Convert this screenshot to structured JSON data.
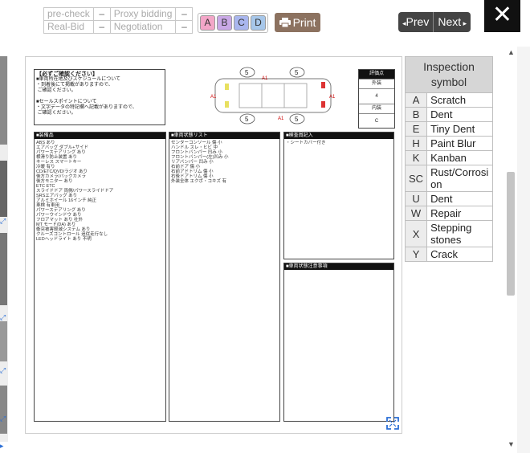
{
  "status": {
    "rows": [
      {
        "left_label": "pre-check",
        "left_value": "–",
        "right_label": "Proxy bidding",
        "right_value": "–"
      },
      {
        "left_label": "Real-Bid",
        "left_value": "–",
        "right_label": "Negotiation",
        "right_value": "–"
      }
    ]
  },
  "grade_buttons": [
    {
      "label": "A",
      "color": "#f3a6c8"
    },
    {
      "label": "B",
      "color": "#c9a8e6"
    },
    {
      "label": "C",
      "color": "#a9b6ee"
    },
    {
      "label": "D",
      "color": "#a7c7ea"
    }
  ],
  "print": {
    "label": "Print",
    "icon": "printer-icon"
  },
  "nav": {
    "prev_label": "Prev",
    "next_label": "Next"
  },
  "close": {
    "icon": "close-icon"
  },
  "sheet": {
    "confirm_title": "【必ずご確認ください】",
    "confirm_body": "■車両所在地及びスケジュールについて\n・到着後にて掲載がありますので、\n ご確認ください。\n\n■セールスポイントについて\n・文字データの特記欄へ記載がありますので、\n ご確認ください。",
    "rating_header": "評価点",
    "rating_exterior_label": "外装",
    "rating_exterior_value": "4",
    "rating_interior_label": "内装",
    "rating_interior_value": "C",
    "equipment_title": "■装備品",
    "equipment_body": "ABS あり\nエアバッグ ダブル+サイド\nパワーステアリング あり\n横滑り防止装置 あり\nキーレス スマートキー\n冷暖 有り\nCD/ETC/DVD/ラジオ あり\n後方カメラ/バックカメラ\n後方モニター あり\nETC ETC\nスライドドア 両側/パワースライドドア\nSRSエアバッグ あり\nアルミホイール 16インチ 純正\n車検 有車用\nパワーステアリング あり\nパワーウインドウ あり\nフロアマット あり 社外\nMT モード/DA) あり\n衝突被害軽減システム あり\nクルーズコントロール 追従走行なし\nLEDヘッドライト あり 不明",
    "condition_title": "■車両状態リスト",
    "condition_body": "センターコンソール 傷 小\nハンドル スレ・ヒビ 中\nフロントバンパー 凹み 小\nフロントバンパー(左)凹み 小\nリアバンパー 凹み 小\n右前ドア 傷 小\n右前アドトリム 傷 小\n右後ドアトリム 傷 小\n外装全体 エクボ・コキズ 有",
    "inspect_title": "■検査員記入",
    "inspect_body": "・シートカバー付き",
    "notes_title": "■車両状態注意事項",
    "notes_body": "",
    "diagram_marks": [
      "5",
      "5",
      "5",
      "5",
      "A1",
      "A1",
      "A1",
      "A1"
    ]
  },
  "legend": {
    "title": "Inspection symbol",
    "rows": [
      {
        "code": "A",
        "name": "Scratch"
      },
      {
        "code": "B",
        "name": "Dent"
      },
      {
        "code": "E",
        "name": "Tiny Dent"
      },
      {
        "code": "H",
        "name": "Paint Blur"
      },
      {
        "code": "K",
        "name": "Kanban"
      },
      {
        "code": "SC",
        "name": "Rust/Corrosion"
      },
      {
        "code": "U",
        "name": "Dent"
      },
      {
        "code": "W",
        "name": "Repair"
      },
      {
        "code": "X",
        "name": "Stepping stones"
      },
      {
        "code": "Y",
        "name": "Crack"
      }
    ]
  }
}
